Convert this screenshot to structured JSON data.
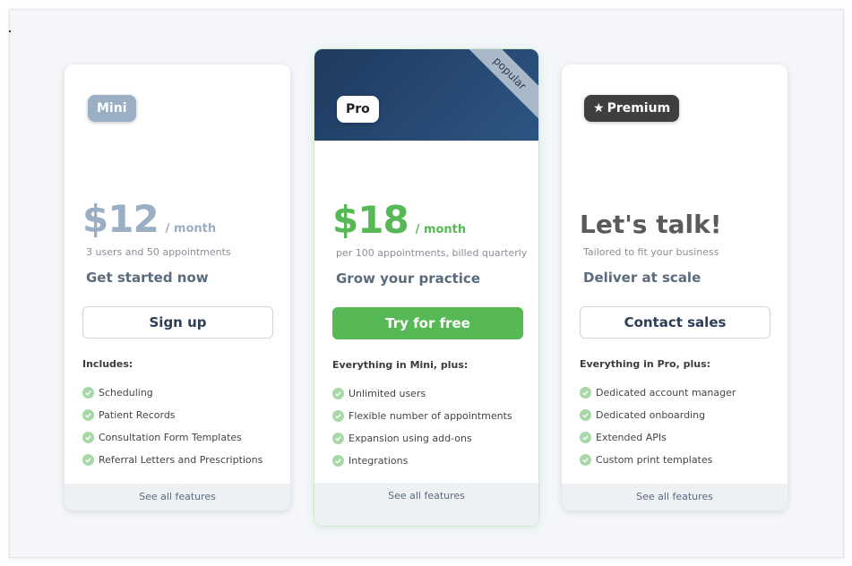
{
  "plans": {
    "mini": {
      "badge": "Mini",
      "price": "$12",
      "period": "/ month",
      "subline": "3 users and 50 appointments",
      "tagline": "Get started now",
      "cta": "Sign up",
      "includes": "Includes:",
      "features": [
        "Scheduling",
        "Patient Records",
        "Consultation Form Templates",
        "Referral Letters and Prescriptions"
      ],
      "see_all": "See all features"
    },
    "pro": {
      "ribbon": "popular",
      "badge": "Pro",
      "price": "$18",
      "period": "/ month",
      "subline": "per 100 appointments, billed quarterly",
      "tagline": "Grow your practice",
      "cta": "Try for free",
      "includes": "Everything in Mini, plus:",
      "features": [
        "Unlimited users",
        "Flexible number of appointments",
        "Expansion using add-ons",
        "Integrations"
      ],
      "see_all": "See all features"
    },
    "premium": {
      "badge_icon": "star-icon",
      "badge": "Premium",
      "price": "Let's talk!",
      "subline": "Tailored to fit your business",
      "tagline": "Deliver at scale",
      "cta": "Contact sales",
      "includes": "Everything in Pro, plus:",
      "features": [
        "Dedicated account manager",
        "Dedicated onboarding",
        "Extended APIs",
        "Custom print templates"
      ],
      "see_all": "See all features"
    }
  },
  "colors": {
    "mini_accent": "#9aaec4",
    "pro_accent": "#56b956",
    "pro_header": "#1f3a5f",
    "premium_badge": "#3f3f3f"
  }
}
